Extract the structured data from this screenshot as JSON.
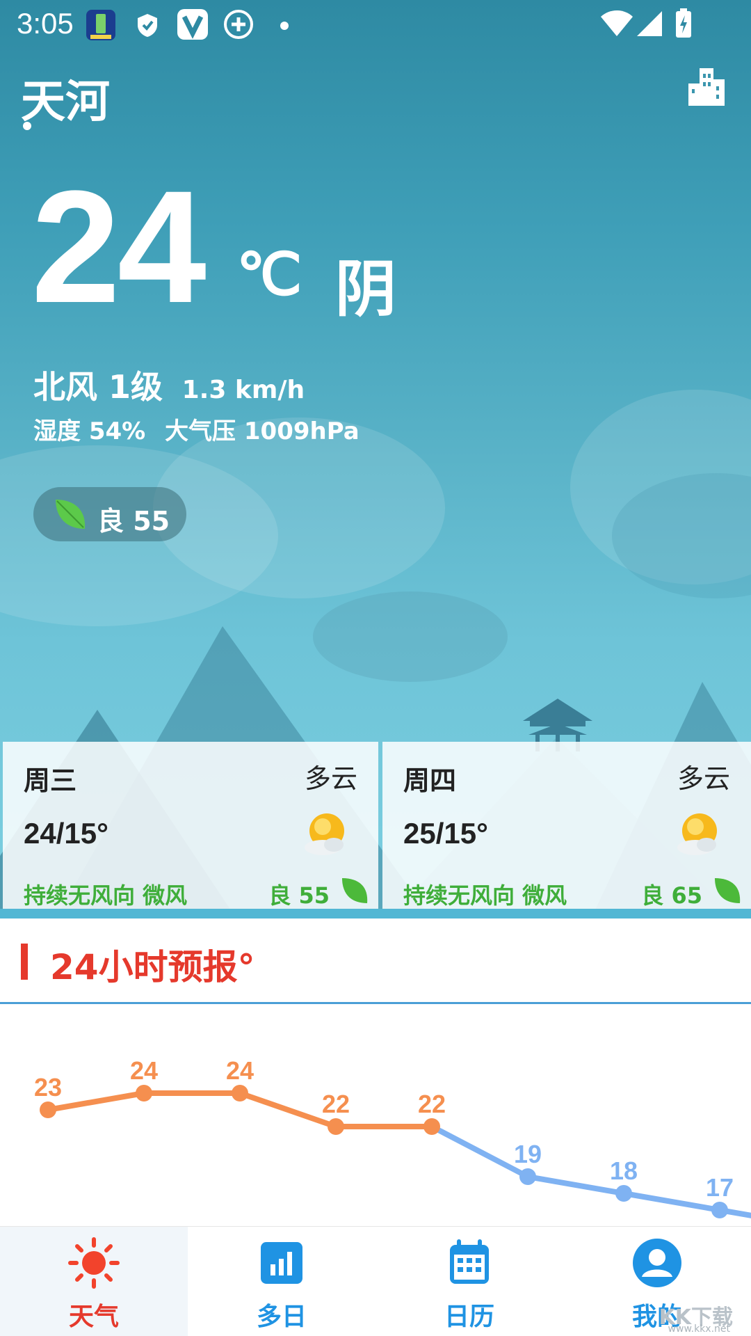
{
  "status_bar": {
    "time": "3:05",
    "icons": [
      "battery-app-icon",
      "shield-icon",
      "v-app-icon",
      "add-circle-icon",
      "dot-icon",
      "wifi-icon",
      "signal-icon",
      "battery-charging-icon"
    ]
  },
  "header": {
    "city": "天河",
    "city_icon": "building-icon"
  },
  "current": {
    "temperature": "24",
    "unit": "℃",
    "condition": "阴",
    "wind_direction": "北风 1级",
    "wind_speed": "1.3 km/h",
    "humidity": "湿度 54%",
    "pressure": "大气压 1009hPa",
    "aqi_text": "良  55"
  },
  "forecast_cards": [
    {
      "day": "周三",
      "condition": "多云",
      "temps": "24/15°",
      "wind": "持续无风向  微风",
      "aqi": "良  55"
    },
    {
      "day": "周四",
      "condition": "多云",
      "temps": "25/15°",
      "wind": "持续无风向  微风",
      "aqi": "良  65"
    }
  ],
  "hourly_section": {
    "title": "24小时预报°"
  },
  "chart_data": {
    "type": "line",
    "values": [
      23,
      24,
      24,
      22,
      22,
      19,
      18,
      17
    ],
    "colors": {
      "warm": "#f58f4f",
      "cool": "#7fb2f2"
    }
  },
  "bottom_nav": [
    {
      "label": "天气",
      "icon": "sun-icon",
      "active": true
    },
    {
      "label": "多日",
      "icon": "bar-chart-icon",
      "active": false
    },
    {
      "label": "日历",
      "icon": "calendar-icon",
      "active": false
    },
    {
      "label": "我的",
      "icon": "profile-icon",
      "active": false
    }
  ],
  "colors": {
    "accent_red": "#e5392c",
    "nav_blue": "#1f93e3",
    "aqi_green": "#3fae3a"
  },
  "watermark": {
    "text": "KK下载",
    "url": "www.kkx.net"
  }
}
